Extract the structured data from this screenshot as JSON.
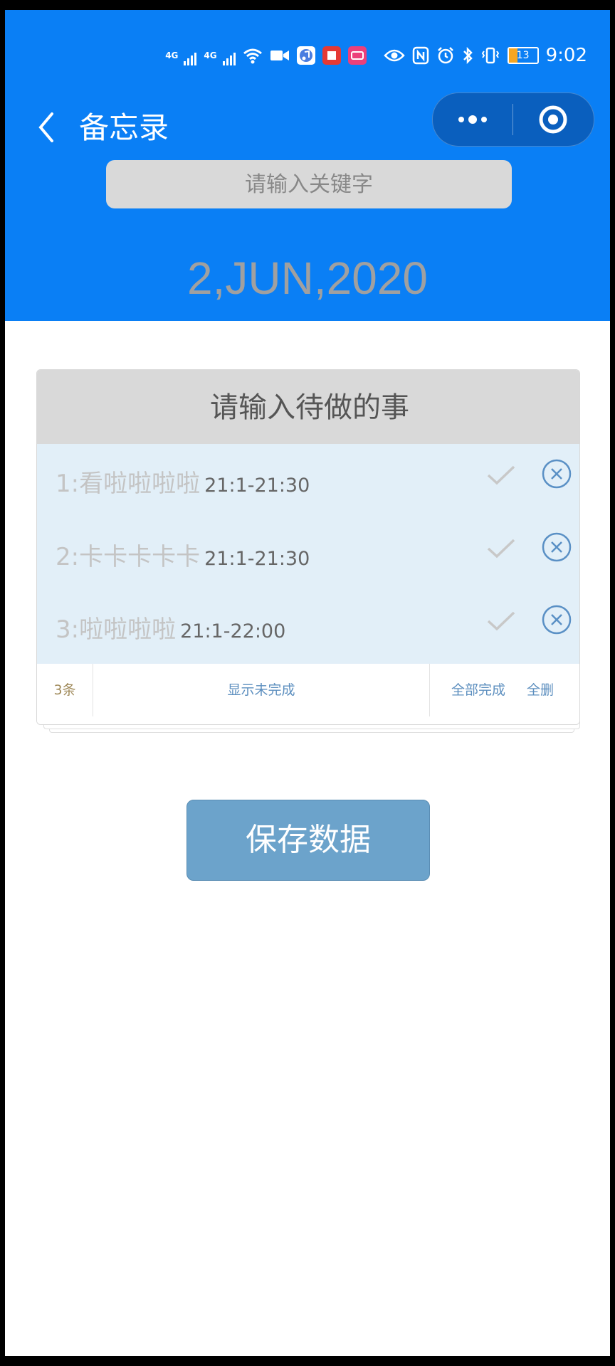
{
  "status_bar": {
    "signal1_label": "4G",
    "signal2_label": "4G",
    "battery_level": "13",
    "time": "9:02",
    "icons": [
      "wifi-icon",
      "video-call-icon",
      "music-app-icon",
      "book-app-icon",
      "card-app-icon",
      "eye-icon",
      "nfc-icon",
      "alarm-icon",
      "bluetooth-icon",
      "vibrate-icon",
      "battery-icon"
    ]
  },
  "nav": {
    "title": "备忘录",
    "back_icon": "chevron-left-icon",
    "more_icon": "more-dots-icon",
    "close_icon": "target-circle-icon"
  },
  "search": {
    "placeholder": "请输入关键字"
  },
  "date": "2,JUN,2020",
  "todo": {
    "input_placeholder": "请输入待做的事",
    "items": [
      {
        "text": "1:看啦啦啦啦",
        "time": "21:1-21:30"
      },
      {
        "text": "2:卡卡卡卡卡",
        "time": "21:1-21:30"
      },
      {
        "text": "3:啦啦啦啦",
        "time": "21:1-22:00"
      }
    ],
    "footer": {
      "count": "3条",
      "filter": "显示未完成",
      "complete_all": "全部完成",
      "delete_all": "全删"
    }
  },
  "save_button": "保存数据",
  "colors": {
    "header_bg": "#0a7ff5",
    "list_bg": "#e2eff8",
    "save_button_bg": "#6ca3cb",
    "input_bg": "#d9d9d9"
  }
}
